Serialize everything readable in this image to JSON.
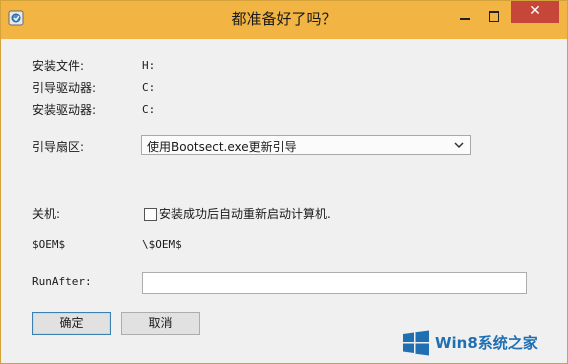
{
  "window": {
    "title": "都准备好了吗？",
    "close_glyph": "✕"
  },
  "form": {
    "rows": [
      {
        "label": "安装文件:",
        "value": "H:"
      },
      {
        "label": "引导驱动器:",
        "value": "C:"
      },
      {
        "label": "安装驱动器:",
        "value": "C:"
      }
    ],
    "boot_sector": {
      "label": "引导扇区:",
      "selected": "使用Bootsect.exe更新引导"
    },
    "shutdown": {
      "label": "关机:",
      "checkbox_label": "安装成功后自动重新启动计算机.",
      "checked": false
    },
    "oem": {
      "label": "$OEM$",
      "value": "\\$OEM$"
    },
    "run_after": {
      "label": "RunAfter:",
      "value": ""
    }
  },
  "buttons": {
    "ok": "确定",
    "cancel": "取消"
  },
  "watermark": {
    "text": "Win8系统之家"
  },
  "colors": {
    "titlebar": "#f2b443",
    "close": "#c7463a",
    "watermark": "#1f6fb2"
  }
}
